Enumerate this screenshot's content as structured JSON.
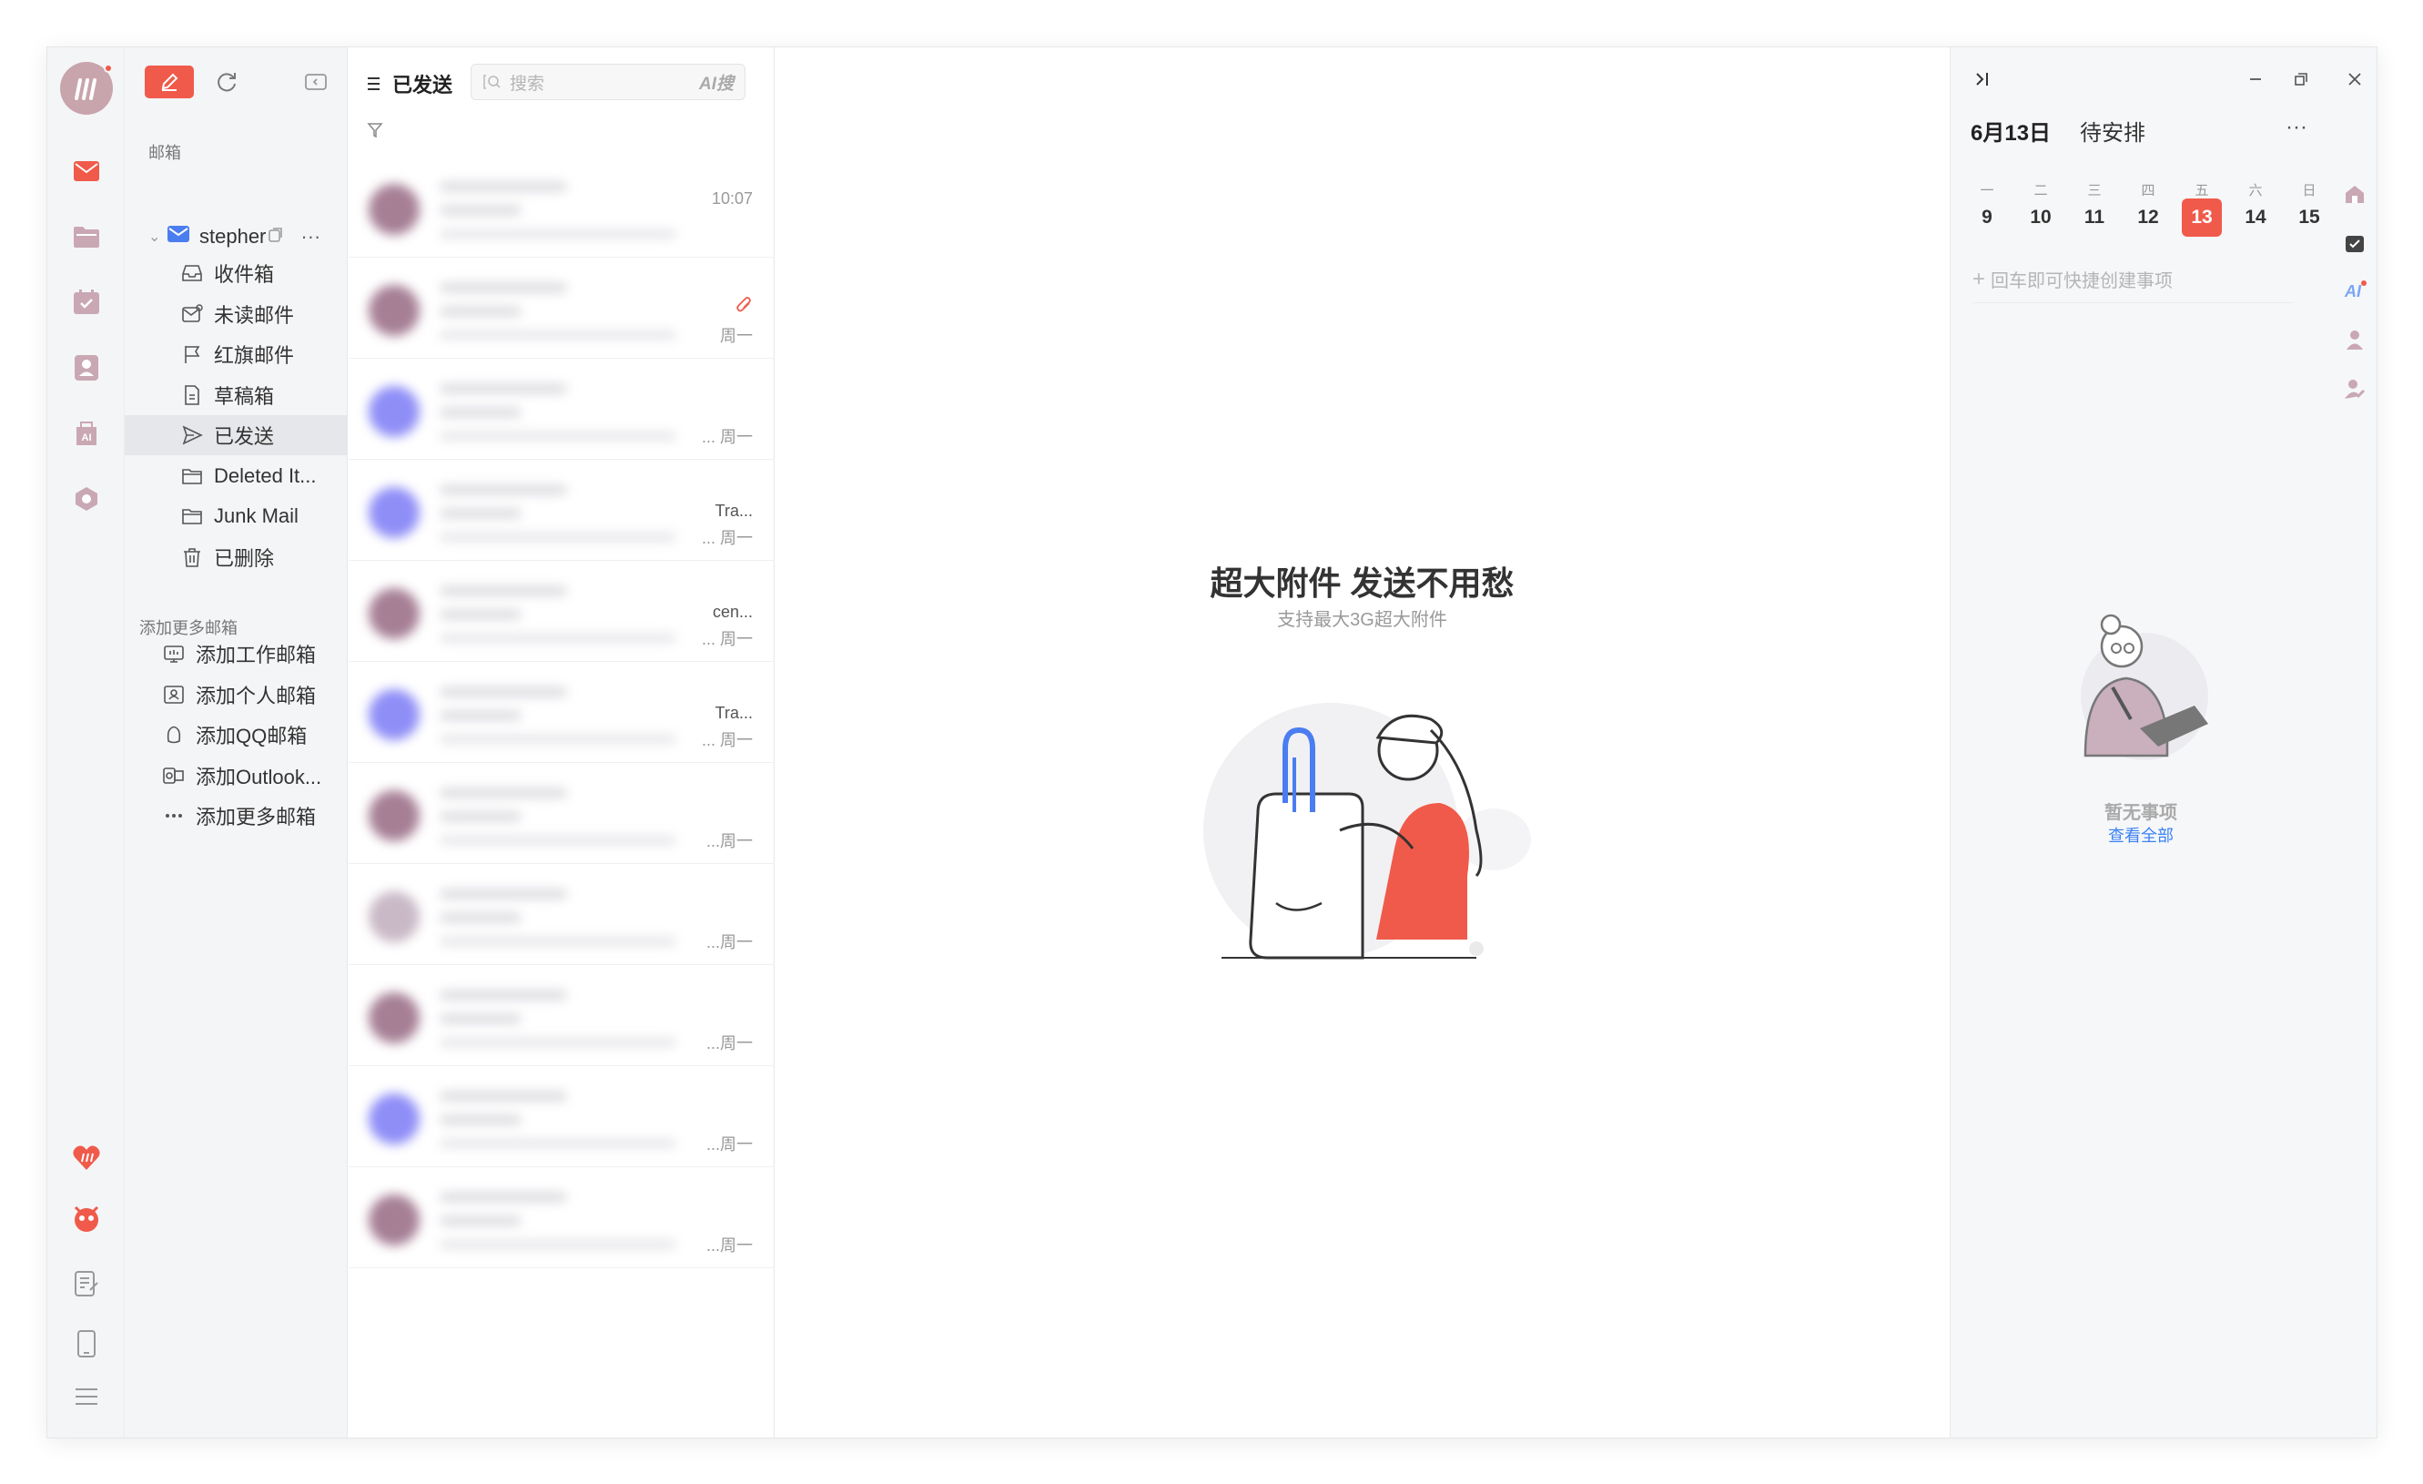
{
  "sidebar": {
    "mailbox_label": "邮箱",
    "account_name": "stepher",
    "folders": [
      {
        "label": "收件箱",
        "icon": "inbox-icon"
      },
      {
        "label": "未读邮件",
        "icon": "unread-mail-icon"
      },
      {
        "label": "红旗邮件",
        "icon": "flag-icon"
      },
      {
        "label": "草稿箱",
        "icon": "draft-icon"
      },
      {
        "label": "已发送",
        "icon": "send-icon"
      },
      {
        "label": "Deleted It...",
        "icon": "folder-icon"
      },
      {
        "label": "Junk Mail",
        "icon": "folder-icon"
      },
      {
        "label": "已删除",
        "icon": "trash-icon"
      }
    ],
    "add_more_label": "添加更多邮箱",
    "add_items": [
      {
        "label": "添加工作邮箱",
        "icon": "work-mail-icon"
      },
      {
        "label": "添加个人邮箱",
        "icon": "personal-mail-icon"
      },
      {
        "label": "添加QQ邮箱",
        "icon": "qq-icon"
      },
      {
        "label": "添加Outlook...",
        "icon": "outlook-icon"
      },
      {
        "label": "添加更多邮箱",
        "icon": "more-dots-icon"
      }
    ]
  },
  "list": {
    "title": "已发送",
    "search_placeholder": "搜索",
    "ai_search_label": "AI搜",
    "items": [
      {
        "subject": "",
        "time": "10:07",
        "avatar": "#a67f95",
        "attachment": false
      },
      {
        "subject": "",
        "time": "周一",
        "avatar": "#a67f95",
        "attachment": true
      },
      {
        "subject": "",
        "time": "... 周一",
        "avatar": "#8f8ef7",
        "attachment": false
      },
      {
        "subject": "Tra...",
        "time": "... 周一",
        "avatar": "#8f8ef7",
        "attachment": false
      },
      {
        "subject": "cen...",
        "time": "... 周一",
        "avatar": "#a67f95",
        "attachment": false
      },
      {
        "subject": "Tra...",
        "time": "... 周一",
        "avatar": "#8f8ef7",
        "attachment": false
      },
      {
        "subject": "",
        "time": "...周一",
        "avatar": "#a67f95",
        "attachment": false
      },
      {
        "subject": "",
        "time": "...周一",
        "avatar": "#c9b9c6",
        "attachment": false
      },
      {
        "subject": "",
        "time": "...周一",
        "avatar": "#a67f95",
        "attachment": false
      },
      {
        "subject": "",
        "time": "...周一",
        "avatar": "#8f8ef7",
        "attachment": false
      },
      {
        "subject": "",
        "time": "...周一",
        "avatar": "#a67f95",
        "attachment": false
      }
    ]
  },
  "reader": {
    "title": "超大附件 发送不用愁",
    "subtitle": "支持最大3G超大附件"
  },
  "calendar": {
    "date": "6月13日",
    "status": "待安排",
    "more": "···",
    "week_labels": [
      "一",
      "二",
      "三",
      "四",
      "五",
      "六",
      "日"
    ],
    "week_days": [
      "9",
      "10",
      "11",
      "12",
      "13",
      "14",
      "15"
    ],
    "today_index": 4,
    "quick_add_placeholder": "回车即可快捷创建事项",
    "no_items": "暂无事项",
    "view_all": "查看全部"
  },
  "colors": {
    "accent": "#f05a4a",
    "link": "#3b82f6"
  }
}
